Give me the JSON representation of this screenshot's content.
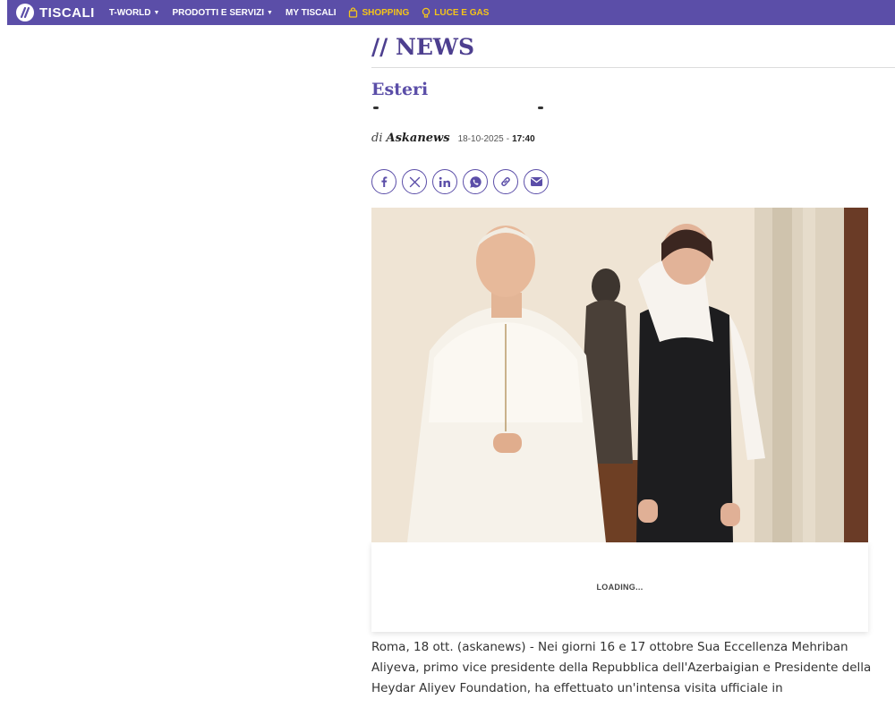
{
  "nav": {
    "brand": "TISCALI",
    "items": [
      {
        "label": "T-WORLD",
        "dropdown": true
      },
      {
        "label": "PRODOTTI E SERVIZI",
        "dropdown": true
      },
      {
        "label": "MY TISCALI",
        "dropdown": false
      }
    ],
    "shopping": "SHOPPING",
    "luce_gas": "LUCE E GAS",
    "colors": {
      "bar": "#5b4ea8",
      "accent": "#f5c518"
    }
  },
  "article": {
    "section": "// NEWS",
    "category": "Esteri",
    "byline_prefix": "di",
    "author": "Askanews",
    "date": "18-10-2025",
    "date_sep": "-",
    "time": "17:40",
    "share": [
      "facebook-icon",
      "x-icon",
      "linkedin-icon",
      "whatsapp-icon",
      "link-icon",
      "email-icon"
    ],
    "loading": "LOADING...",
    "body": "Roma, 18 ott. (askanews) - Nei giorni 16 e 17 ottobre Sua Eccellenza Mehriban Aliyeva, primo vice presidente della Repubblica dell'Azerbaigian e Presidente della Heydar Aliyev Foundation, ha effettuato un'intensa visita ufficiale in"
  }
}
